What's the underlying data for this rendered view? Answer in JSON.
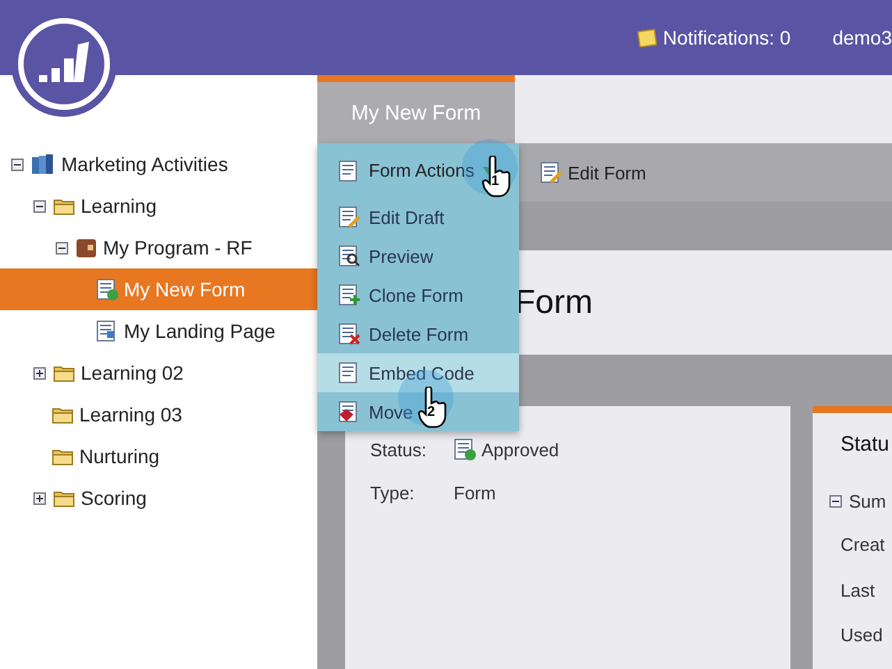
{
  "header": {
    "notifications": "Notifications: 0",
    "user": "demo3"
  },
  "tree": [
    {
      "label": "Marketing Activities",
      "kind": "root",
      "expanded": true,
      "selected": false,
      "children": [
        {
          "label": "Learning",
          "kind": "folder",
          "expanded": true,
          "selected": false,
          "children": [
            {
              "label": "My Program - RF",
              "kind": "program",
              "expanded": true,
              "selected": false,
              "children": [
                {
                  "label": "My New Form",
                  "kind": "form",
                  "selected": true
                },
                {
                  "label": "My Landing Page",
                  "kind": "landing",
                  "selected": false
                }
              ]
            }
          ]
        },
        {
          "label": "Learning 02",
          "kind": "folder",
          "expanded": false,
          "selected": false
        },
        {
          "label": "Learning 03",
          "kind": "folder",
          "selected": false
        },
        {
          "label": "Nurturing",
          "kind": "folder",
          "selected": false
        },
        {
          "label": "Scoring",
          "kind": "folder",
          "expanded": false,
          "selected": false
        }
      ]
    }
  ],
  "tab": {
    "label": "My New Form",
    "selected": true
  },
  "toolbar": {
    "menu_button": "Form Actions",
    "edit_button": "Edit Form"
  },
  "menu": [
    {
      "label": "Edit Draft",
      "kind": "edit",
      "selected": false
    },
    {
      "label": "Preview",
      "kind": "preview",
      "selected": false
    },
    {
      "label": "Clone Form",
      "kind": "clone",
      "selected": false
    },
    {
      "label": "Delete Form",
      "kind": "delete",
      "selected": false
    },
    {
      "label": "Embed Code",
      "kind": "embed",
      "selected": true
    },
    {
      "label": "Move",
      "kind": "move",
      "selected": false
    }
  ],
  "heading": "Form",
  "details": [
    {
      "label": "Status:",
      "value": "Approved",
      "kind": "approved"
    },
    {
      "label": "Type:",
      "value": "Form",
      "kind": "plain"
    }
  ],
  "side_panel": {
    "title": "Statu",
    "section": "Sum",
    "expanded": true,
    "rows": [
      "Creat",
      "Last",
      "Used"
    ]
  },
  "cursors": [
    {
      "step": "1"
    },
    {
      "step": "2"
    }
  ]
}
